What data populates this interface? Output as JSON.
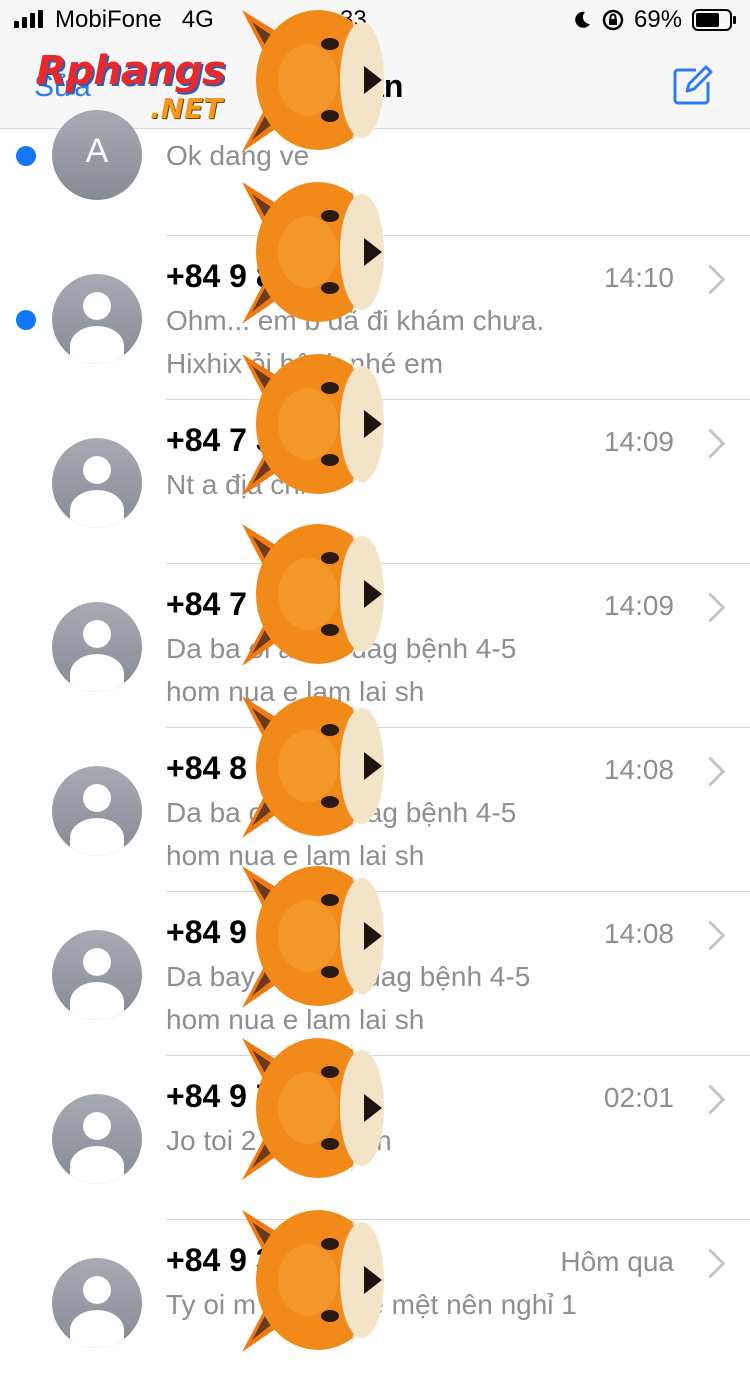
{
  "status_bar": {
    "carrier": "MobiFone",
    "network": "4G",
    "time": "33",
    "battery_percent": "69%"
  },
  "nav": {
    "edit_label": "Sửa",
    "title": "nắn",
    "compose_icon": "compose-icon"
  },
  "watermark": {
    "main": "Rphangs",
    "sub": ".NET"
  },
  "colors": {
    "accent": "#2f7bf6",
    "unread": "#1477f8",
    "secondary_text": "#8e8e93"
  },
  "conversations": [
    {
      "avatar": "A",
      "name": "",
      "time": "",
      "preview_1": "Ok dang ve",
      "preview_2": "",
      "unread": true
    },
    {
      "avatar": "",
      "name": "+84 9        833",
      "time": "14:10",
      "preview_1": "Ohm... em b    đã đi khám chưa.",
      "preview_2": "Hixhix      ỏi bệnh nhé em",
      "unread": true
    },
    {
      "avatar": "",
      "name": "+84 7        330",
      "time": "14:09",
      "preview_1": "Nt a địa chi",
      "preview_2": "",
      "unread": false
    },
    {
      "avatar": "",
      "name": "+84 7        995",
      "time": "14:09",
      "preview_1": "Da ba        oi ah. E dag bệnh 4-5",
      "preview_2": "hom nua e lam lai sh",
      "unread": false
    },
    {
      "avatar": "",
      "name": "+84 8        138",
      "time": "14:08",
      "preview_1": "Da ba        oi ah. E dag bệnh 4-5",
      "preview_2": "hom nua e lam lai sh",
      "unread": false
    },
    {
      "avatar": "",
      "name": "+84 9        298",
      "time": "14:08",
      "preview_1": "Da bay        oi ah. E dag bệnh 4-5",
      "preview_2": "hom nua e lam lai sh",
      "unread": false
    },
    {
      "avatar": "",
      "name": "+84 9        789",
      "time": "02:01",
      "preview_1": "Jo toi        2 cai e di bn",
      "preview_2": "",
      "unread": false
    },
    {
      "avatar": "",
      "name": "+84 9        370",
      "time": "Hôm qua",
      "preview_1": "Ty oi m        ah. Nay e mệt nên nghỉ 1",
      "preview_2": "",
      "unread": false
    }
  ]
}
